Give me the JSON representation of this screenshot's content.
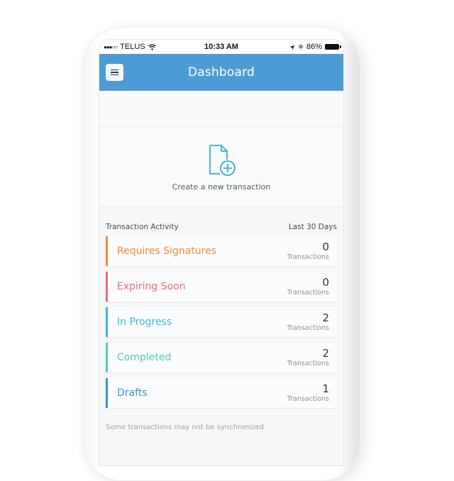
{
  "status_bar": {
    "signal_dots": "●●●○○",
    "carrier": "TELUS",
    "wifi_icon": "wifi-icon",
    "time": "10:33 AM",
    "location_icon": "➤",
    "bluetooth_icon": "✱",
    "battery_percent": "86%"
  },
  "header": {
    "menu_icon": "hamburger-icon",
    "title": "Dashboard",
    "color": "#4d9bd5"
  },
  "create": {
    "icon": "new-document-plus-icon",
    "label": "Create a new transaction",
    "icon_color": "#2fb0d8"
  },
  "activity": {
    "title": "Transaction Activity",
    "period": "Last 30 Days",
    "items": [
      {
        "label": "Requires Signatures",
        "count": "0",
        "unit": "Transactions",
        "color": "#f38a3a"
      },
      {
        "label": "Expiring Soon",
        "count": "0",
        "unit": "Transactions",
        "color": "#ee6a73"
      },
      {
        "label": "In Progress",
        "count": "2",
        "unit": "Transactions",
        "color": "#3eb6d9"
      },
      {
        "label": "Completed",
        "count": "2",
        "unit": "Transactions",
        "color": "#4fcdb2"
      },
      {
        "label": "Drafts",
        "count": "1",
        "unit": "Transactions",
        "color": "#3a8fd0"
      }
    ],
    "footnote": "Some transactions may not be synchronized"
  }
}
